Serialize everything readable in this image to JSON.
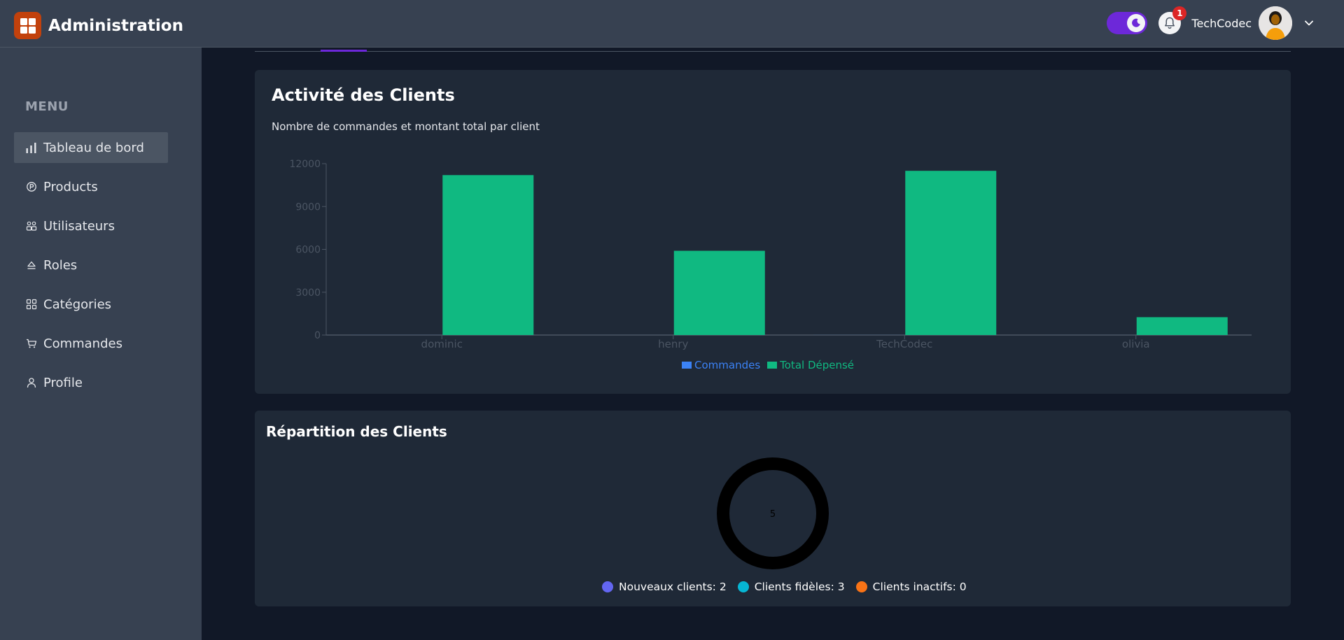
{
  "header": {
    "title": "Administration",
    "username": "TechCodec",
    "notification_count": "1",
    "dark_mode": true
  },
  "sidebar": {
    "menu_label": "MENU",
    "items": [
      {
        "label": "Tableau de bord",
        "icon": "bar-chart-icon",
        "active": true
      },
      {
        "label": "Products",
        "icon": "product-icon",
        "active": false
      },
      {
        "label": "Utilisateurs",
        "icon": "users-icon",
        "active": false
      },
      {
        "label": "Roles",
        "icon": "roles-icon",
        "active": false
      },
      {
        "label": "Catégories",
        "icon": "grid-icon",
        "active": false
      },
      {
        "label": "Commandes",
        "icon": "cart-icon",
        "active": false
      },
      {
        "label": "Profile",
        "icon": "user-icon",
        "active": false
      }
    ]
  },
  "activity": {
    "title": "Activité des Clients",
    "subtitle": "Nombre de commandes et montant total par client"
  },
  "repartition": {
    "title": "Répartition des Clients",
    "center_value": "5",
    "legend": [
      {
        "label": "Nouveaux clients: 2",
        "color": "#6366f1"
      },
      {
        "label": "Clients fidèles: 3",
        "color": "#06b6d4"
      },
      {
        "label": "Clients inactifs: 0",
        "color": "#f97316"
      }
    ]
  },
  "colors": {
    "commandes": "#3b82f6",
    "total": "#10b981",
    "accent": "#6d28d9",
    "brand": "#c2410c"
  },
  "chart_data": [
    {
      "type": "bar",
      "categories": [
        "dominic",
        "henry",
        "TechCodec",
        "olivia"
      ],
      "series": [
        {
          "name": "Commandes",
          "values": [
            2,
            1,
            3,
            1
          ]
        },
        {
          "name": "Total Dépensé",
          "values": [
            11200,
            5900,
            11500,
            1250
          ]
        }
      ],
      "yticks": [
        "0",
        "3000",
        "6000",
        "9000",
        "12000"
      ],
      "ylim": [
        0,
        12000
      ],
      "legend_position": "bottom"
    },
    {
      "type": "pie",
      "categories": [
        "Nouveaux clients",
        "Clients fidèles",
        "Clients inactifs"
      ],
      "values": [
        2,
        3,
        0
      ]
    }
  ]
}
